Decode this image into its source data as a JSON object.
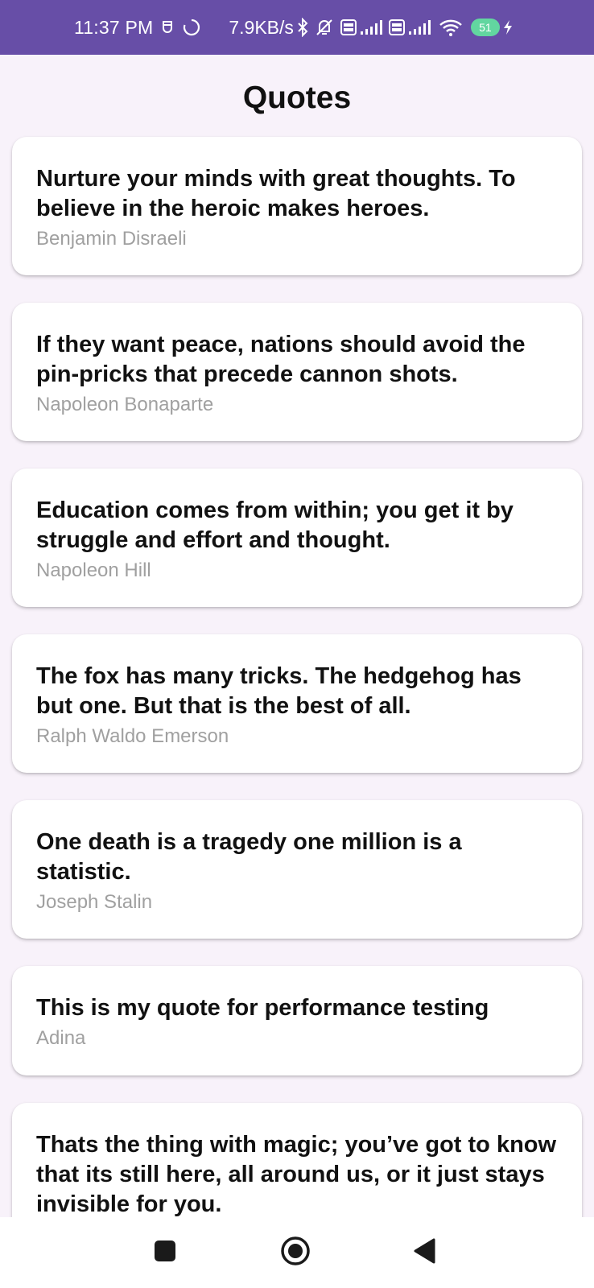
{
  "status_bar": {
    "time": "11:37 PM",
    "speed": "7.9KB/s",
    "battery": "51",
    "sim_badge": "Vo\nLTE",
    "icons": [
      "alarm-icon",
      "sync-icon",
      "bluetooth-icon",
      "mute-icon",
      "volte-icon",
      "signal-icon",
      "volte-icon",
      "signal-icon",
      "wifi-icon",
      "battery-icon",
      "charging-icon"
    ]
  },
  "header": {
    "title": "Quotes"
  },
  "quotes": [
    {
      "text": "Nurture your minds with great thoughts. To believe in the heroic makes heroes.",
      "author": "Benjamin Disraeli"
    },
    {
      "text": "If they want peace, nations should avoid the pin-pricks that precede cannon shots.",
      "author": "Napoleon Bonaparte"
    },
    {
      "text": "Education comes from within; you get it by struggle and effort and thought.",
      "author": "Napoleon Hill"
    },
    {
      "text": "The fox has many tricks. The hedgehog has but one. But that is the best of all.",
      "author": "Ralph Waldo Emerson"
    },
    {
      "text": "One death is a tragedy one million is a statistic.",
      "author": "Joseph Stalin"
    },
    {
      "text": "This is my quote for performance testing",
      "author": "Adina"
    },
    {
      "text": "Thats the thing with magic; you’ve got to know that its still here, all around us, or it just stays invisible for you.",
      "author": ""
    }
  ],
  "nav_bar": {
    "buttons": [
      "recents-icon",
      "home-icon",
      "back-icon"
    ]
  },
  "colors": {
    "status_bar": "#674ea7",
    "background": "#f8f2fa",
    "card": "#ffffff",
    "author_text": "#a0a0a0",
    "battery": "#62d6a0"
  }
}
